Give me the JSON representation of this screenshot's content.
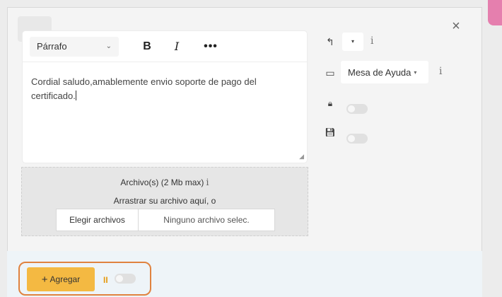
{
  "window": {
    "close_glyph": "×"
  },
  "editor": {
    "format_select": "Párrafo",
    "format_chevron": "⌄",
    "bold": "B",
    "italic": "I",
    "more": "•••",
    "text": "Cordial saludo,amablemente envio soporte de pago del certificado.",
    "resize_glyph": "◢"
  },
  "upload": {
    "title": "Archivo(s) (2 Mb max)",
    "info": "i",
    "drag_text": "Arrastrar su archivo aquí, o",
    "choose_label": "Elegir archivos",
    "status": "Ninguno archivo selec."
  },
  "sidebar": {
    "reply_icon": "reply-icon",
    "reply_glyph": "↰",
    "reply_select_glyph": "▾",
    "reply_info": "i",
    "inbox_icon": "inbox-icon",
    "inbox_glyph": "▭",
    "department_value": "Mesa de Ayuda",
    "department_chevron": "▾",
    "department_info": "i",
    "lock_icon": "lock-icon",
    "lock_glyph": "🔒︎",
    "save_icon": "save-icon",
    "save_glyph": "💾︎"
  },
  "footer": {
    "add_plus": "+",
    "add_label": "Agregar",
    "pause_glyph": "II"
  },
  "colors": {
    "accent": "#f4b942",
    "highlight": "#e0823f",
    "pause": "#e59a10",
    "pink_tab": "#e57fae"
  }
}
